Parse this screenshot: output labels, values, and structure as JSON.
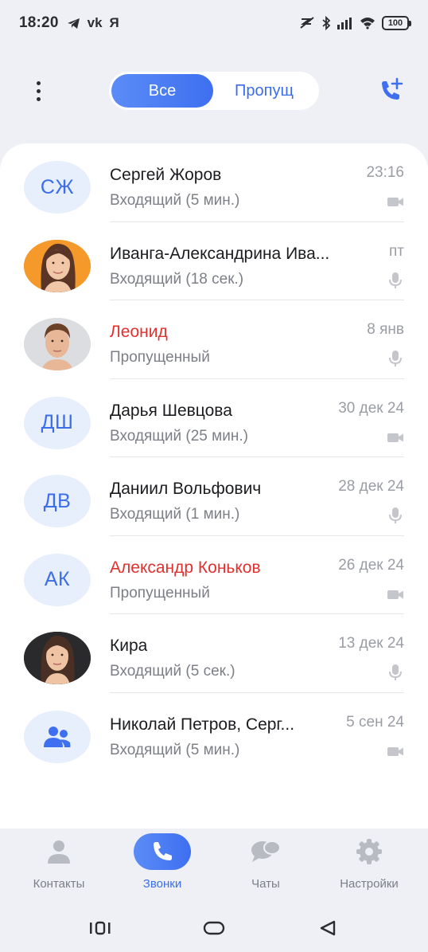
{
  "status_bar": {
    "time": "18:20",
    "left_icons": [
      "telegram-icon",
      "vk-icon",
      "yandex-icon"
    ],
    "left_labels": {
      "vk": "vk",
      "yandex": "Я"
    },
    "right_icons": [
      "mute-icon",
      "bluetooth-icon",
      "signal-icon",
      "wifi-icon"
    ],
    "battery": "100"
  },
  "top_bar": {
    "menu_icon": "more-vertical-icon",
    "tabs": [
      {
        "label": "Все",
        "active": true
      },
      {
        "label": "Пропущ",
        "active": false
      }
    ],
    "add_call_icon": "add-call-icon"
  },
  "calls": [
    {
      "avatar_type": "initials",
      "initials": "СЖ",
      "name": "Сергей Жоров",
      "status": "Входящий (5 мин.)",
      "date": "23:16",
      "call_type": "video",
      "missed": false
    },
    {
      "avatar_type": "photo",
      "photo": "woman-orange",
      "name": "Иванга-Александрина Ива...",
      "status": "Входящий (18 сек.)",
      "date": "пт",
      "call_type": "audio",
      "missed": false
    },
    {
      "avatar_type": "photo",
      "photo": "man-grey",
      "name": "Леонид",
      "status": "Пропущенный",
      "date": "8 янв",
      "call_type": "audio",
      "missed": true
    },
    {
      "avatar_type": "initials",
      "initials": "ДШ",
      "name": "Дарья Шевцова",
      "status": "Входящий (25 мин.)",
      "date": "30 дек 24",
      "call_type": "video",
      "missed": false
    },
    {
      "avatar_type": "initials",
      "initials": "ДВ",
      "name": "Даниил Вольфович",
      "status": "Входящий (1 мин.)",
      "date": "28 дек 24",
      "call_type": "audio",
      "missed": false
    },
    {
      "avatar_type": "initials",
      "initials": "АК",
      "name": "Александр Коньков",
      "status": "Пропущенный",
      "date": "26 дек 24",
      "call_type": "video",
      "missed": true
    },
    {
      "avatar_type": "photo",
      "photo": "woman-dark",
      "name": "Кира",
      "status": "Входящий (5 сек.)",
      "date": "13 дек 24",
      "call_type": "audio",
      "missed": false
    },
    {
      "avatar_type": "group",
      "name": "Николай Петров, Серг...",
      "status": "Входящий (5 мин.)",
      "date": "5 сен 24",
      "call_type": "video",
      "missed": false
    }
  ],
  "bottom_nav": [
    {
      "label": "Контакты",
      "icon": "person-icon",
      "active": false
    },
    {
      "label": "Звонки",
      "icon": "phone-icon",
      "active": true
    },
    {
      "label": "Чаты",
      "icon": "chat-icon",
      "active": false
    },
    {
      "label": "Настройки",
      "icon": "gear-icon",
      "active": false
    }
  ],
  "system_nav": [
    "recents-icon",
    "home-icon",
    "back-icon"
  ],
  "colors": {
    "accent": "#3e6ff0",
    "missed": "#e0312f",
    "avatar_bg": "#e7eefc",
    "background": "#eef0f5"
  }
}
